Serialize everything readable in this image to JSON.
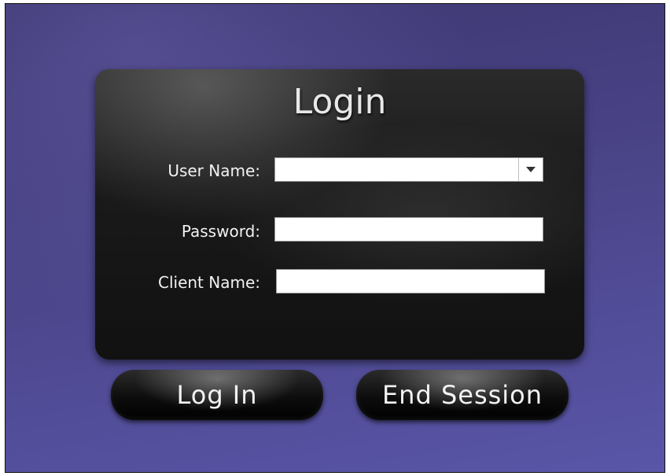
{
  "login": {
    "title": "Login",
    "username_label": "User Name:",
    "username_value": "",
    "password_label": "Password:",
    "password_value": "",
    "client_label": "Client Name:",
    "client_value": ""
  },
  "buttons": {
    "login_label": "Log In",
    "end_session_label": "End Session"
  },
  "colors": {
    "background": "#4a4488",
    "panel": "#1a1a1a",
    "text": "#f2f2f2"
  }
}
